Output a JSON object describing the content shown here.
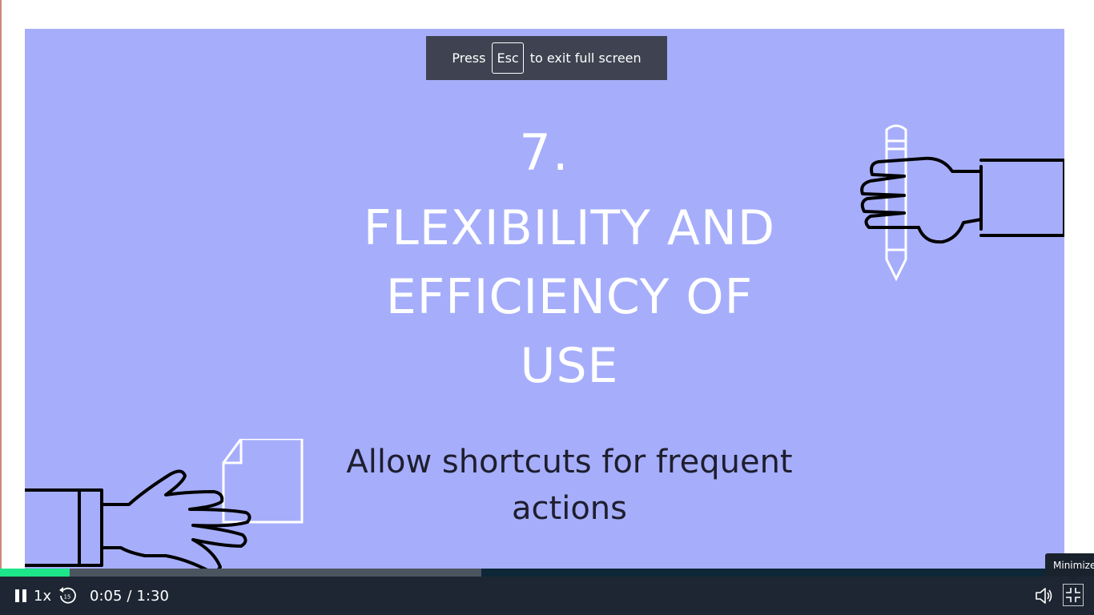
{
  "toast": {
    "prefix": "Press",
    "key": "Esc",
    "suffix": "to exit full screen"
  },
  "slide": {
    "number": "7.",
    "heading_lines": [
      "FLEXIBILITY AND",
      "EFFICIENCY OF",
      "USE"
    ],
    "subtitle_lines": [
      "Allow shortcuts for frequent",
      "actions"
    ]
  },
  "player": {
    "speed": "1x",
    "rewind_seconds": "15",
    "current_time": "0:05",
    "separator": "/",
    "duration": "1:30",
    "progress_played": 0.0637,
    "progress_buffered": 0.44,
    "tooltip": "Minimize",
    "colors": {
      "played": "#1de589",
      "buffered": "#4a5560",
      "track": "#0d2737",
      "controls_bg": "#1d2632",
      "slide_bg": "#a6aefb"
    },
    "icons": [
      "pause-icon",
      "rewind-15-icon",
      "volume-icon",
      "minimize-icon"
    ]
  }
}
